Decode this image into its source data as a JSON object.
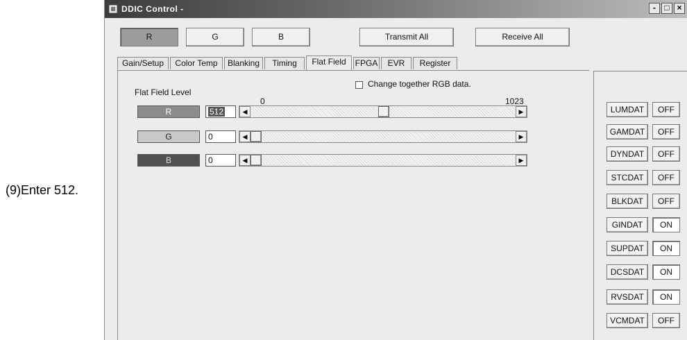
{
  "annotation": {
    "text": "(9)Enter 512."
  },
  "window": {
    "title": "DDIC Control -",
    "controls": {
      "minimize": "-",
      "maximize": "□",
      "close": "×"
    }
  },
  "toolbar": {
    "channel_buttons": [
      {
        "label": "R",
        "pressed": true
      },
      {
        "label": "G",
        "pressed": false
      },
      {
        "label": "B",
        "pressed": false
      }
    ],
    "transmit_all": "Transmit All",
    "receive_all": "Receive All"
  },
  "tabs": [
    {
      "label": "Gain/Setup",
      "active": false
    },
    {
      "label": "Color Temp",
      "active": false
    },
    {
      "label": "Blanking",
      "active": false
    },
    {
      "label": "Timing",
      "active": false
    },
    {
      "label": "Flat Field",
      "active": true
    },
    {
      "label": "FPGA",
      "active": false
    },
    {
      "label": "EVR",
      "active": false
    },
    {
      "label": "Register",
      "active": false
    }
  ],
  "flat_field": {
    "section_label": "Flat Field Level",
    "change_together_label": "Change together RGB data.",
    "change_together_checked": false,
    "scale_min": "0",
    "scale_max": "1023",
    "range": [
      0,
      1023
    ],
    "channels": [
      {
        "label": "R",
        "value": "512",
        "level": 512,
        "color": "#8c8c8c",
        "text_color": "#ffffff"
      },
      {
        "label": "G",
        "value": "0",
        "level": 0,
        "color": "#c8c8c8",
        "text_color": "#222222"
      },
      {
        "label": "B",
        "value": "0",
        "level": 0,
        "color": "#505050",
        "text_color": "#dddddd"
      }
    ]
  },
  "data_status": [
    {
      "name": "LUMDAT",
      "state": "OFF"
    },
    {
      "name": "GAMDAT",
      "state": "OFF"
    },
    {
      "name": "DYNDAT",
      "state": "OFF"
    },
    {
      "name": "STCDAT",
      "state": "OFF"
    },
    {
      "name": "BLKDAT",
      "state": "OFF"
    },
    {
      "name": "GINDAT",
      "state": "ON"
    },
    {
      "name": "SUPDAT",
      "state": "ON"
    },
    {
      "name": "DCSDAT",
      "state": "ON"
    },
    {
      "name": "RVSDAT",
      "state": "ON"
    },
    {
      "name": "VCMDAT",
      "state": "OFF"
    }
  ]
}
